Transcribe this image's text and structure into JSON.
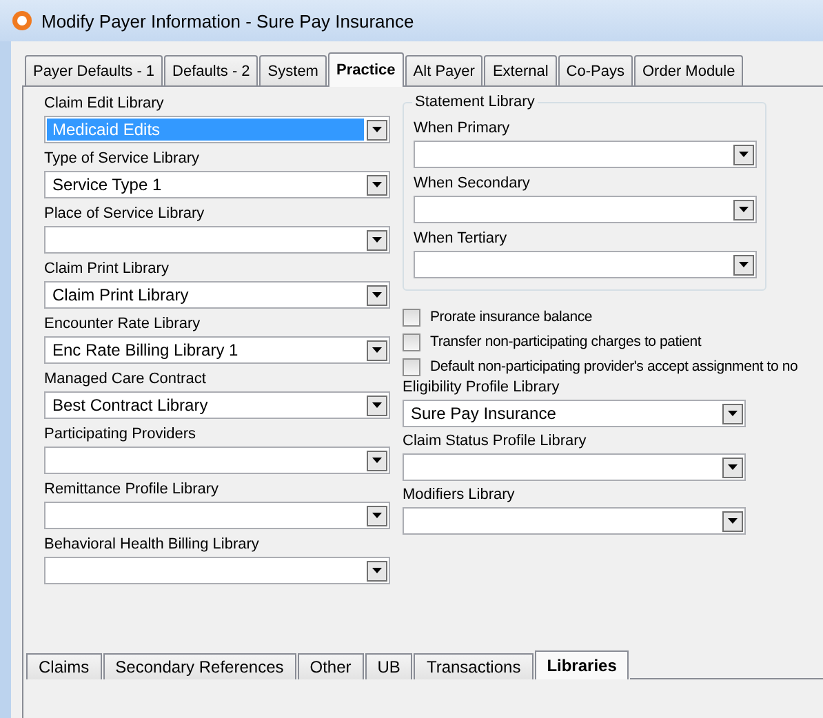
{
  "window": {
    "title": "Modify Payer Information - Sure Pay Insurance"
  },
  "tabs": [
    {
      "label": "Payer Defaults - 1",
      "selected": false
    },
    {
      "label": "Defaults - 2",
      "selected": false
    },
    {
      "label": "System",
      "selected": false
    },
    {
      "label": "Practice",
      "selected": true
    },
    {
      "label": "Alt Payer",
      "selected": false
    },
    {
      "label": "External",
      "selected": false
    },
    {
      "label": "Co-Pays",
      "selected": false
    },
    {
      "label": "Order Module",
      "selected": false
    }
  ],
  "left_fields": [
    {
      "label": "Claim Edit Library",
      "value": "Medicaid Edits",
      "highlighted": true
    },
    {
      "label": "Type of Service Library",
      "value": "Service Type 1",
      "highlighted": false
    },
    {
      "label": "Place of Service Library",
      "highlighted": false
    },
    {
      "label": "Claim Print Library",
      "value": "Claim Print Library",
      "highlighted": false
    },
    {
      "label": "Encounter Rate Library",
      "value": "Enc Rate Billing Library 1",
      "highlighted": false
    },
    {
      "label": "Managed Care Contract",
      "value": "Best Contract Library",
      "highlighted": false
    },
    {
      "label": "Participating Providers",
      "highlighted": false
    },
    {
      "label": "Remittance Profile Library",
      "highlighted": false
    },
    {
      "label": "Behavioral Health Billing Library",
      "highlighted": false
    }
  ],
  "statement_library": {
    "title": "Statement Library",
    "fields": [
      {
        "label": "When Primary"
      },
      {
        "label": "When Secondary"
      },
      {
        "label": "When Tertiary"
      }
    ]
  },
  "checkboxes": [
    {
      "label": "Prorate insurance balance",
      "checked": false
    },
    {
      "label": "Transfer non-participating charges to patient",
      "checked": false
    },
    {
      "label": "Default non-participating provider's accept assignment to no",
      "checked": false
    }
  ],
  "right_fields": [
    {
      "label": "Eligibility Profile Library",
      "value": "Sure Pay Insurance"
    },
    {
      "label": "Claim Status Profile Library"
    },
    {
      "label": "Modifiers Library"
    }
  ],
  "bottom_tabs": [
    {
      "label": "Claims",
      "selected": false
    },
    {
      "label": "Secondary References",
      "selected": false
    },
    {
      "label": "Other",
      "selected": false
    },
    {
      "label": "UB",
      "selected": false
    },
    {
      "label": "Transactions",
      "selected": false
    },
    {
      "label": "Libraries",
      "selected": true
    }
  ]
}
